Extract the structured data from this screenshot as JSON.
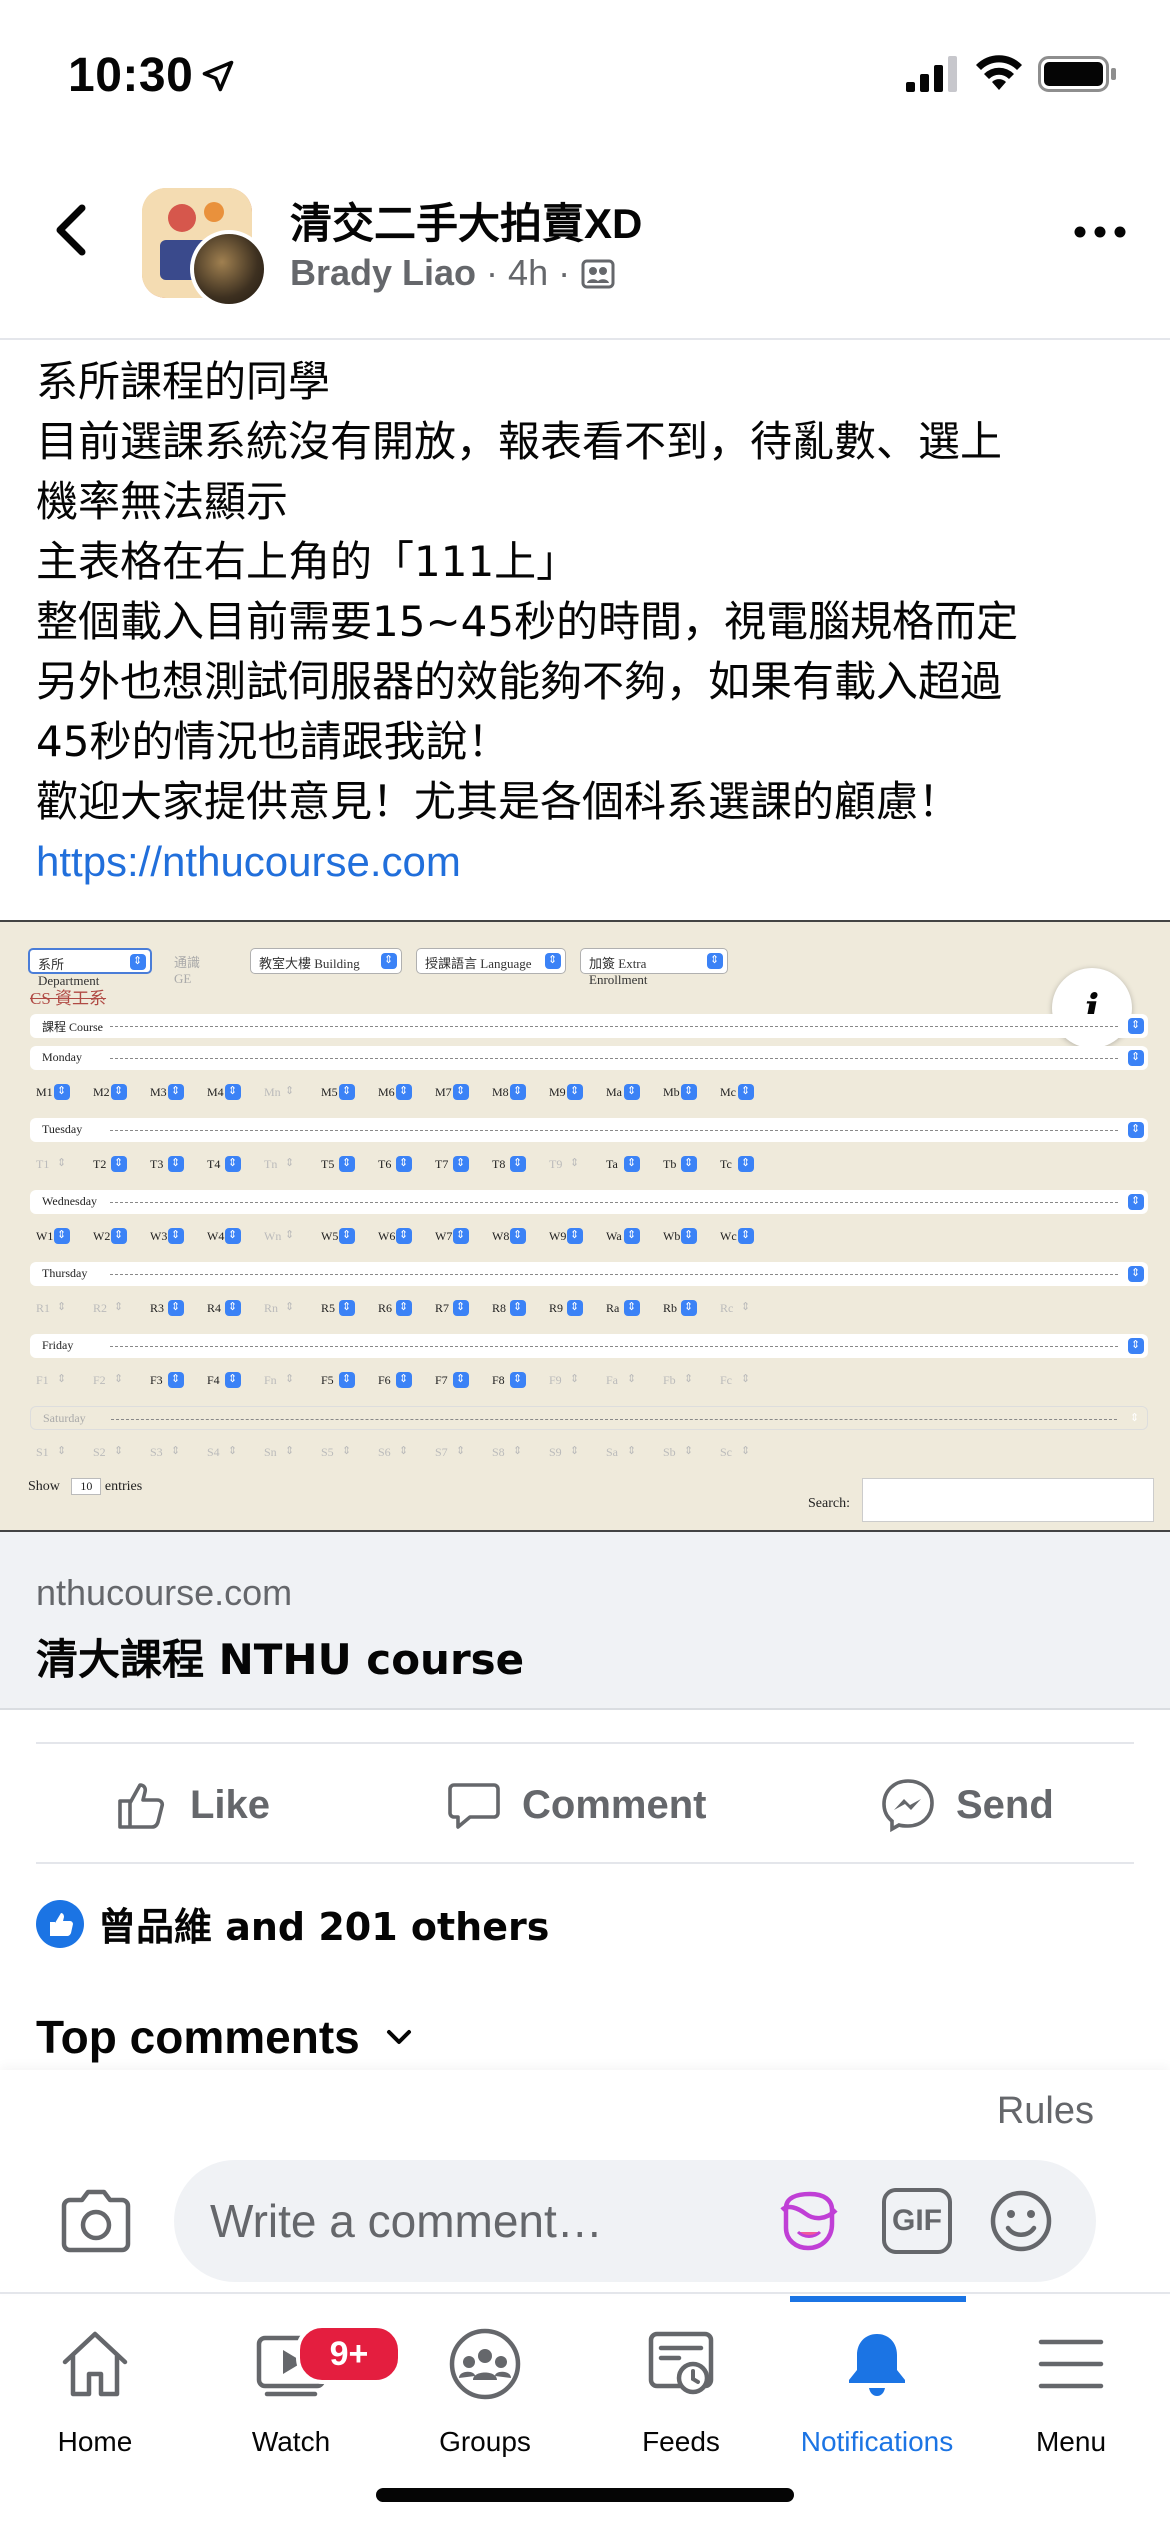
{
  "status": {
    "time": "10:30"
  },
  "header": {
    "group_name": "清交二手大拍賣XD",
    "author": "Brady Liao",
    "time_ago": "4h",
    "dot": "·"
  },
  "post": {
    "lines": [
      "系所課程的同學",
      "目前選課系統沒有開放，報表看不到，待亂數、選上",
      "機率無法顯示",
      "主表格在右上角的「111上」",
      "整個載入目前需要15~45秒的時間，視電腦規格而定",
      "另外也想測試伺服器的效能夠不夠，如果有載入超過",
      "45秒的情況也請跟我說！",
      "歡迎大家提供意見！尤其是各個科系選課的顧慮！"
    ],
    "link": "https://nthucourse.com"
  },
  "preview": {
    "filters": [
      "系所 Department",
      "通識 GE",
      "教室大樓 Building",
      "授課語言 Language",
      "加簽 Extra Enrollment"
    ],
    "dept": "CS 資工系",
    "info_icon": "i",
    "course_row": "課程 Course",
    "days": [
      {
        "name": "Monday",
        "chips": [
          "M1",
          "M2",
          "M3",
          "M4",
          "Mn",
          "M5",
          "M6",
          "M7",
          "M8",
          "M9",
          "Ma",
          "Mb",
          "Mc"
        ],
        "disabled": [
          "Mn"
        ]
      },
      {
        "name": "Tuesday",
        "chips": [
          "T1",
          "T2",
          "T3",
          "T4",
          "Tn",
          "T5",
          "T6",
          "T7",
          "T8",
          "T9",
          "Ta",
          "Tb",
          "Tc"
        ],
        "disabled": [
          "T1",
          "Tn",
          "T9"
        ]
      },
      {
        "name": "Wednesday",
        "chips": [
          "W1",
          "W2",
          "W3",
          "W4",
          "Wn",
          "W5",
          "W6",
          "W7",
          "W8",
          "W9",
          "Wa",
          "Wb",
          "Wc"
        ],
        "disabled": [
          "Wn"
        ]
      },
      {
        "name": "Thursday",
        "chips": [
          "R1",
          "R2",
          "R3",
          "R4",
          "Rn",
          "R5",
          "R6",
          "R7",
          "R8",
          "R9",
          "Ra",
          "Rb",
          "Rc"
        ],
        "disabled": [
          "R1",
          "R2",
          "Rn",
          "Rc"
        ]
      },
      {
        "name": "Friday",
        "chips": [
          "F1",
          "F2",
          "F3",
          "F4",
          "Fn",
          "F5",
          "F6",
          "F7",
          "F8",
          "F9",
          "Fa",
          "Fb",
          "Fc"
        ],
        "disabled": [
          "F1",
          "F2",
          "Fn",
          "F9",
          "Fa",
          "Fb",
          "Fc"
        ]
      },
      {
        "name": "Saturday",
        "chips": [
          "S1",
          "S2",
          "S3",
          "S4",
          "Sn",
          "S5",
          "S6",
          "S7",
          "S8",
          "S9",
          "Sa",
          "Sb",
          "Sc"
        ],
        "disabled": [
          "S1",
          "S2",
          "S3",
          "S4",
          "Sn",
          "S5",
          "S6",
          "S7",
          "S8",
          "S9",
          "Sa",
          "Sb",
          "Sc"
        ],
        "row_disabled": true
      }
    ],
    "show_label": "Show",
    "show_value": "10",
    "entries_label": "entries",
    "search_label": "Search:"
  },
  "link_card": {
    "domain": "nthucourse.com",
    "title": "清大課程 NTHU course"
  },
  "actions": {
    "like": "Like",
    "comment": "Comment",
    "send": "Send"
  },
  "reactions": {
    "text": "曾品維 and 201 others"
  },
  "comments": {
    "heading": "Top comments"
  },
  "composer": {
    "rules": "Rules",
    "placeholder": "Write a comment…",
    "gif": "GIF"
  },
  "tabs": [
    {
      "label": "Home",
      "icon": "home-icon"
    },
    {
      "label": "Watch",
      "icon": "watch-icon",
      "badge": "9+"
    },
    {
      "label": "Groups",
      "icon": "groups-icon"
    },
    {
      "label": "Feeds",
      "icon": "feeds-icon"
    },
    {
      "label": "Notifications",
      "icon": "bell-icon",
      "active": true
    },
    {
      "label": "Menu",
      "icon": "menu-icon"
    }
  ],
  "colors": {
    "accent": "#1b74e4",
    "link": "#216fdb",
    "badge": "#e41e3f",
    "muted": "#65676b"
  }
}
